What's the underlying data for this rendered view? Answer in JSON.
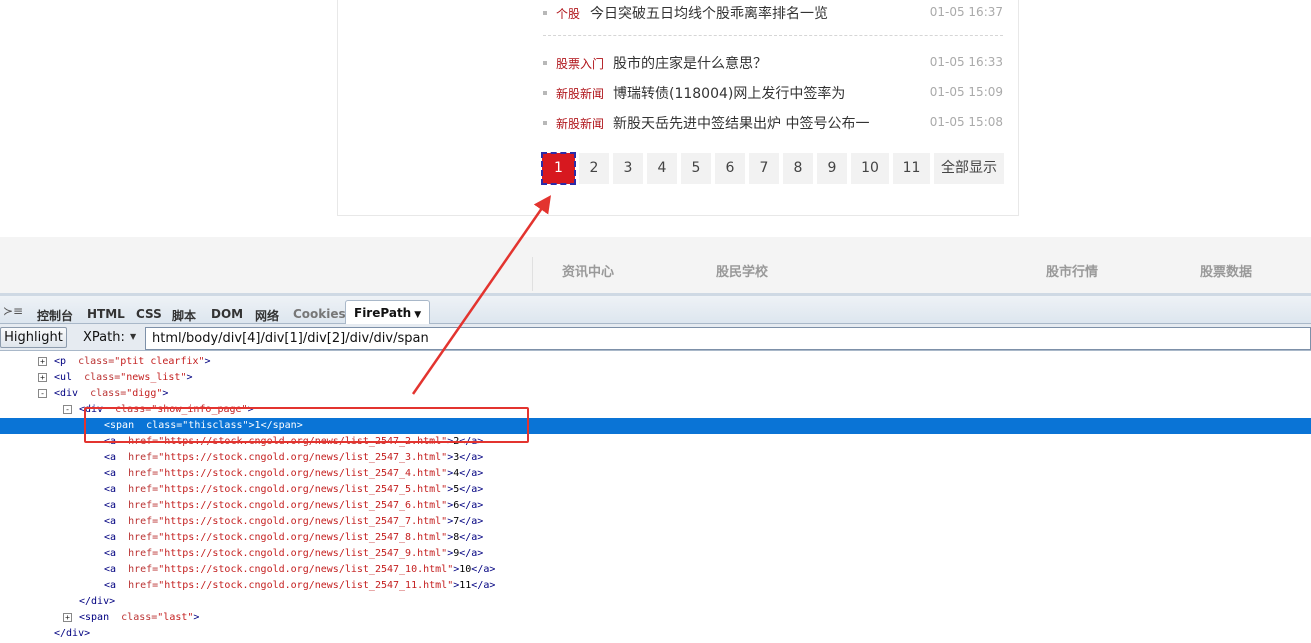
{
  "news": [
    {
      "category": "个股",
      "title": "今日突破五日均线个股乖离率排名一览",
      "time": "01-05 16:37"
    },
    {
      "category": "股票入门",
      "title": "股市的庄家是什么意思？",
      "time": "01-05 16:33"
    },
    {
      "category": "新股新闻",
      "title": "博瑞转债(118004)网上发行中签率为",
      "time": "01-05 15:09"
    },
    {
      "category": "新股新闻",
      "title": "新股天岳先进中签结果出炉 中签号公布一",
      "time": "01-05 15:08"
    }
  ],
  "pagination": {
    "pages": [
      "1",
      "2",
      "3",
      "4",
      "5",
      "6",
      "7",
      "8",
      "9",
      "10",
      "11"
    ],
    "current": "1",
    "show_all": "全部显示"
  },
  "footer_links": [
    "资讯中心",
    "股民学校",
    "股市行情",
    "股票数据"
  ],
  "firebug": {
    "menu_icon": "panel-menu-icon",
    "tabs": [
      "控制台",
      "HTML",
      "CSS",
      "脚本",
      "DOM",
      "网络",
      "Cookies",
      "FirePath"
    ],
    "active_tab": "FirePath",
    "highlight_button": "Highlight",
    "xpath_label": "XPath:",
    "xpath_value": "html/body/div[4]/div[1]/div[2]/div/div/span"
  },
  "tree": [
    {
      "tog": "+",
      "tag": "p",
      "cls": "ptit clearfix",
      "close": ">"
    },
    {
      "tog": "+",
      "tag": "ul",
      "cls": "news_list",
      "close": ">"
    },
    {
      "tog": "-",
      "tag": "div",
      "cls": "digg",
      "close": ">"
    },
    {
      "tog": "-",
      "tag": "div",
      "cls": "show_info_page",
      "close": ">"
    },
    {
      "tag": "span",
      "cls": "thisclass",
      "text": "1",
      "end": "span"
    },
    {
      "tag": "a",
      "href": "https://stock.cngold.org/news/list_2547_2.html",
      "text": "2",
      "end": "a"
    },
    {
      "tag": "a",
      "href": "https://stock.cngold.org/news/list_2547_3.html",
      "text": "3",
      "end": "a"
    },
    {
      "tag": "a",
      "href": "https://stock.cngold.org/news/list_2547_4.html",
      "text": "4",
      "end": "a"
    },
    {
      "tag": "a",
      "href": "https://stock.cngold.org/news/list_2547_5.html",
      "text": "5",
      "end": "a"
    },
    {
      "tag": "a",
      "href": "https://stock.cngold.org/news/list_2547_6.html",
      "text": "6",
      "end": "a"
    },
    {
      "tag": "a",
      "href": "https://stock.cngold.org/news/list_2547_7.html",
      "text": "7",
      "end": "a"
    },
    {
      "tag": "a",
      "href": "https://stock.cngold.org/news/list_2547_8.html",
      "text": "8",
      "end": "a"
    },
    {
      "tag": "a",
      "href": "https://stock.cngold.org/news/list_2547_9.html",
      "text": "9",
      "end": "a"
    },
    {
      "tag": "a",
      "href": "https://stock.cngold.org/news/list_2547_10.html",
      "text": "10",
      "end": "a"
    },
    {
      "tag": "a",
      "href": "https://stock.cngold.org/news/list_2547_11.html",
      "text": "11",
      "end": "a"
    },
    {
      "closing": "div"
    },
    {
      "tog": "+",
      "tag": "span",
      "cls": "last",
      "close": ">"
    },
    {
      "closing": "div"
    }
  ],
  "colors": {
    "accent_red": "#d7181f",
    "selection_blue": "#0a74d6",
    "annotation_red": "#e3342f"
  }
}
